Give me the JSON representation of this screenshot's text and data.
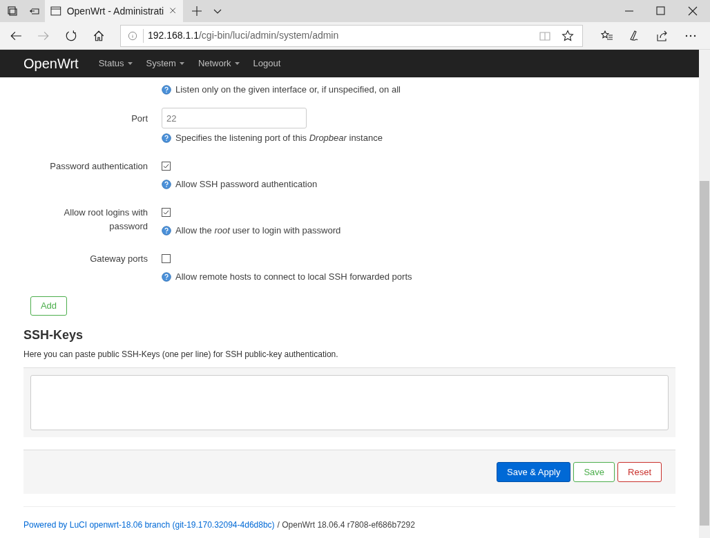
{
  "browser": {
    "tab_title": "OpenWrt - Administrati",
    "url_host": "192.168.1.1",
    "url_path": "/cgi-bin/luci/admin/system/admin"
  },
  "navbar": {
    "brand": "OpenWrt",
    "menus": [
      {
        "label": "Status",
        "dropdown": true
      },
      {
        "label": "System",
        "dropdown": true
      },
      {
        "label": "Network",
        "dropdown": true
      },
      {
        "label": "Logout",
        "dropdown": false
      }
    ]
  },
  "fields": [
    {
      "kind": "cut",
      "description": "Listen only on the given interface or, if unspecified, on all"
    },
    {
      "kind": "text",
      "label": "Port",
      "placeholder": "22",
      "description": "Specifies the listening port of this *Dropbear* instance"
    },
    {
      "kind": "checkbox",
      "label": "Password authentication",
      "checked": true,
      "description": "Allow SSH password authentication"
    },
    {
      "kind": "checkbox",
      "label": "Allow root logins with password",
      "checked": true,
      "description": "Allow the *root* user to login with password"
    },
    {
      "kind": "checkbox",
      "label": "Gateway ports",
      "checked": false,
      "description": "Allow remote hosts to connect to local SSH forwarded ports"
    }
  ],
  "add_button": "Add",
  "ssh_keys": {
    "title": "SSH-Keys",
    "description": "Here you can paste public SSH-Keys (one per line) for SSH public-key authentication."
  },
  "actions": [
    {
      "label": "Save & Apply",
      "kind": "primary"
    },
    {
      "label": "Save",
      "kind": "positive"
    },
    {
      "label": "Reset",
      "kind": "negative"
    }
  ],
  "footer": {
    "link": "Powered by LuCI openwrt-18.06 branch (git-19.170.32094-4d6d8bc)",
    "text": "/ OpenWrt 18.06.4 r7808-ef686b7292"
  }
}
